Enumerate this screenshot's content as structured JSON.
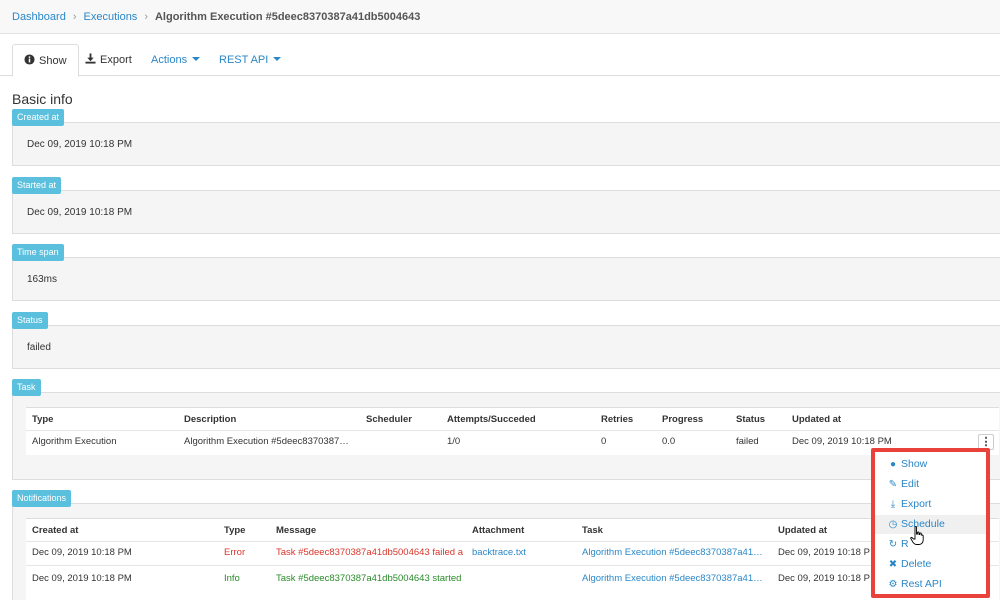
{
  "breadcrumb": {
    "items": [
      "Dashboard",
      "Executions"
    ],
    "current": "Algorithm Execution #5deec8370387a41db5004643"
  },
  "tabs": {
    "show": "Show",
    "export": "Export",
    "actions": "Actions",
    "rest_api": "REST API"
  },
  "basic_info": {
    "title": "Basic info",
    "created_at": {
      "label": "Created at",
      "value": "Dec 09, 2019 10:18 PM"
    },
    "started_at": {
      "label": "Started at",
      "value": "Dec 09, 2019 10:18 PM"
    },
    "time_span": {
      "label": "Time span",
      "value": "163ms"
    },
    "status": {
      "label": "Status",
      "value": "failed"
    }
  },
  "task": {
    "label": "Task",
    "headers": [
      "Type",
      "Description",
      "Scheduler",
      "Attempts/Succeded",
      "Retries",
      "Progress",
      "Status",
      "Updated at"
    ],
    "row": {
      "type": "Algorithm Execution",
      "description": "Algorithm Execution #5deec8370387…",
      "scheduler": "",
      "attempts": "1/0",
      "retries": "0",
      "progress": "0.0",
      "status": "failed",
      "updated_at": "Dec 09, 2019 10:18 PM"
    }
  },
  "notifications": {
    "label": "Notifications",
    "headers": [
      "Created at",
      "Type",
      "Message",
      "Attachment",
      "Task",
      "Updated at"
    ],
    "rows": [
      {
        "created_at": "Dec 09, 2019 10:18 PM",
        "type": "Error",
        "message": "Task #5deec8370387a41db5004643 failed a",
        "attachment": "backtrace.txt",
        "task": "Algorithm Execution #5deec8370387a41…",
        "updated_at": "Dec 09, 2019 10:18 P"
      },
      {
        "created_at": "Dec 09, 2019 10:18 PM",
        "type": "Info",
        "message": "Task #5deec8370387a41db5004643 started",
        "attachment": "",
        "task": "Algorithm Execution #5deec8370387a41…",
        "updated_at": "Dec 09, 2019 10:18 P"
      }
    ]
  },
  "row_menu": {
    "items": [
      "Show",
      "Edit",
      "Export",
      "Schedule",
      "R",
      "Delete",
      "Rest API"
    ],
    "hovered": "Schedule"
  },
  "colors": {
    "accent": "#2a87c7",
    "label_bg": "#5bc0de",
    "highlight_border": "#e8423a",
    "error": "#d9362b",
    "info": "#2a8a2a"
  }
}
